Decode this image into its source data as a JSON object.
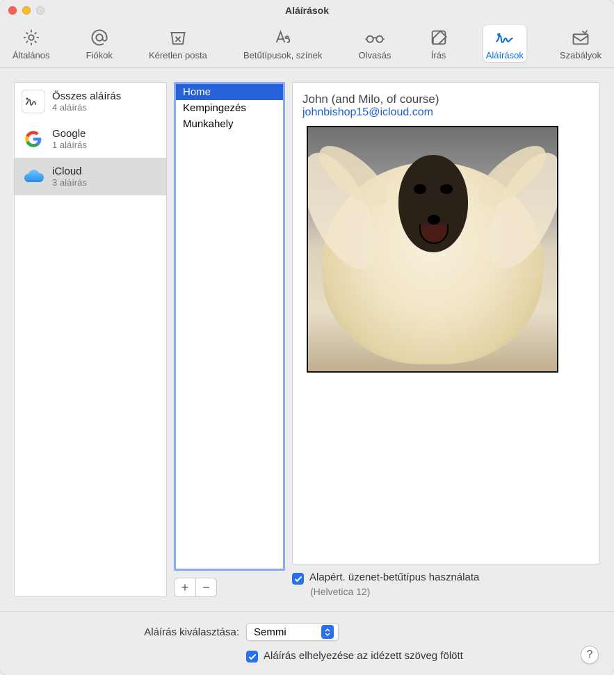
{
  "window": {
    "title": "Aláírások"
  },
  "toolbar": {
    "items": [
      {
        "label": "Általános",
        "icon": "gear"
      },
      {
        "label": "Fiókok",
        "icon": "at"
      },
      {
        "label": "Kéretlen posta",
        "icon": "junk"
      },
      {
        "label": "Betűtípusok, színek",
        "icon": "fonts"
      },
      {
        "label": "Olvasás",
        "icon": "glasses"
      },
      {
        "label": "Írás",
        "icon": "compose"
      },
      {
        "label": "Aláírások",
        "icon": "signature",
        "active": true
      },
      {
        "label": "Szabályok",
        "icon": "rules"
      }
    ]
  },
  "accounts": [
    {
      "name": "Összes aláírás",
      "sub": "4 aláírás",
      "icon": "signature-tile"
    },
    {
      "name": "Google",
      "sub": "1 aláírás",
      "icon": "google"
    },
    {
      "name": "iCloud",
      "sub": "3 aláírás",
      "icon": "icloud",
      "selected": true
    }
  ],
  "signatures": [
    {
      "name": "Home",
      "selected": true
    },
    {
      "name": "Kempingezés"
    },
    {
      "name": "Munkahely"
    }
  ],
  "buttons": {
    "add": "+",
    "remove": "−"
  },
  "preview": {
    "name_line": "John (and Milo, of course)",
    "email": "johnbishop15@icloud.com"
  },
  "default_font": {
    "label": "Alapért. üzenet-betűtípus használata",
    "sub": "(Helvetica 12)",
    "checked": true
  },
  "choose_signature": {
    "label": "Aláírás kiválasztása:",
    "value": "Semmi"
  },
  "place_above": {
    "label": "Aláírás elhelyezése az idézett szöveg fölött",
    "checked": true
  },
  "help": "?"
}
